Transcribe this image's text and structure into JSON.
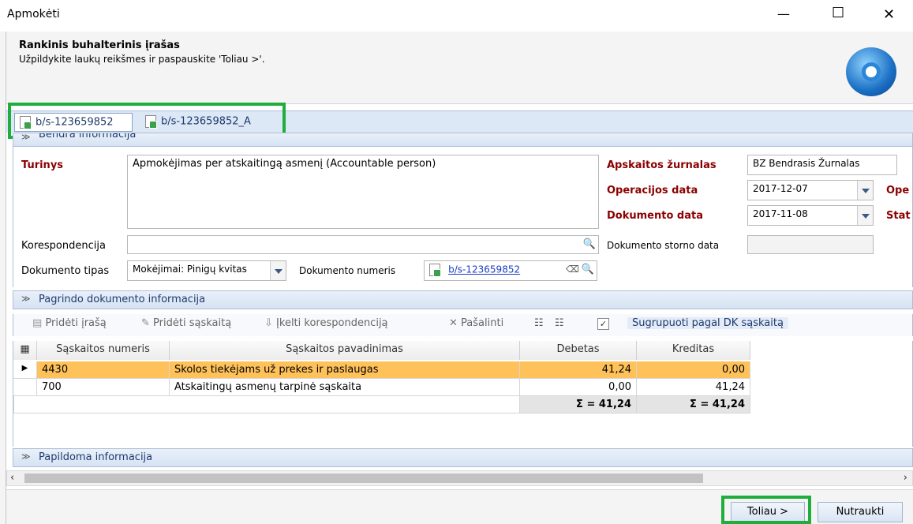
{
  "window": {
    "title": "Apmokėti",
    "minimize": "—",
    "maximize": "☐",
    "close": "✕"
  },
  "header": {
    "title": "Rankinis buhalterinis įrašas",
    "subtitle": "Užpildykite laukų reikšmes ir paspauskite 'Toliau >'."
  },
  "tabs": [
    {
      "label": "b/s-123659852"
    },
    {
      "label": "b/s-123659852_A"
    }
  ],
  "general": {
    "section_label": "Bendra informacija",
    "turinys_label": "Turinys",
    "turinys_value": "Apmokėjimas per atskaitingą asmenį (Accountable person)",
    "korespondencija_label": "Korespondencija",
    "korespondencija_value": "",
    "doc_type_label": "Dokumento tipas",
    "doc_type_value": "Mokėjimai: Pinigų kvitas",
    "doc_number_label": "Dokumento numeris",
    "doc_number_value": "b/s-123659852",
    "journal_label": "Apskaitos žurnalas",
    "journal_value": "BZ Bendrasis Žurnalas",
    "op_date_label": "Operacijos data",
    "op_date_value": "2017-12-07",
    "op_trunc": "Ope",
    "doc_date_label": "Dokumento data",
    "doc_date_value": "2017-11-08",
    "stat_trunc": "Stat",
    "storno_label": "Dokumento storno data",
    "storno_value": ""
  },
  "base_doc_section": "Pagrindo dokumento informacija",
  "toolbar": {
    "add_entry": "Pridėti įrašą",
    "add_account": "Pridėti sąskaitą",
    "load_corr": "Įkelti korespondenciją",
    "delete": "Pašalinti",
    "group_label": "Sugrupuoti pagal DK sąskaitą"
  },
  "grid": {
    "columns": [
      "Sąskaitos numeris",
      "Sąskaitos pavadinimas",
      "Debetas",
      "Kreditas"
    ],
    "rows": [
      {
        "number": "4430",
        "name": "Skolos tiekėjams už prekes ir paslaugas",
        "debit": "41,24",
        "credit": "0,00"
      },
      {
        "number": "700",
        "name": "Atskaitingų asmenų tarpinė sąskaita",
        "debit": "0,00",
        "credit": "41,24"
      }
    ],
    "total_debit": "Σ = 41,24",
    "total_credit": "Σ = 41,24"
  },
  "extra_section": "Papildoma informacija",
  "buttons": {
    "next": "Toliau >",
    "cancel": "Nutraukti"
  },
  "colors": {
    "highlight": "#1fae3d",
    "selected_row": "#ffc25a",
    "label_red": "#8b0000"
  }
}
